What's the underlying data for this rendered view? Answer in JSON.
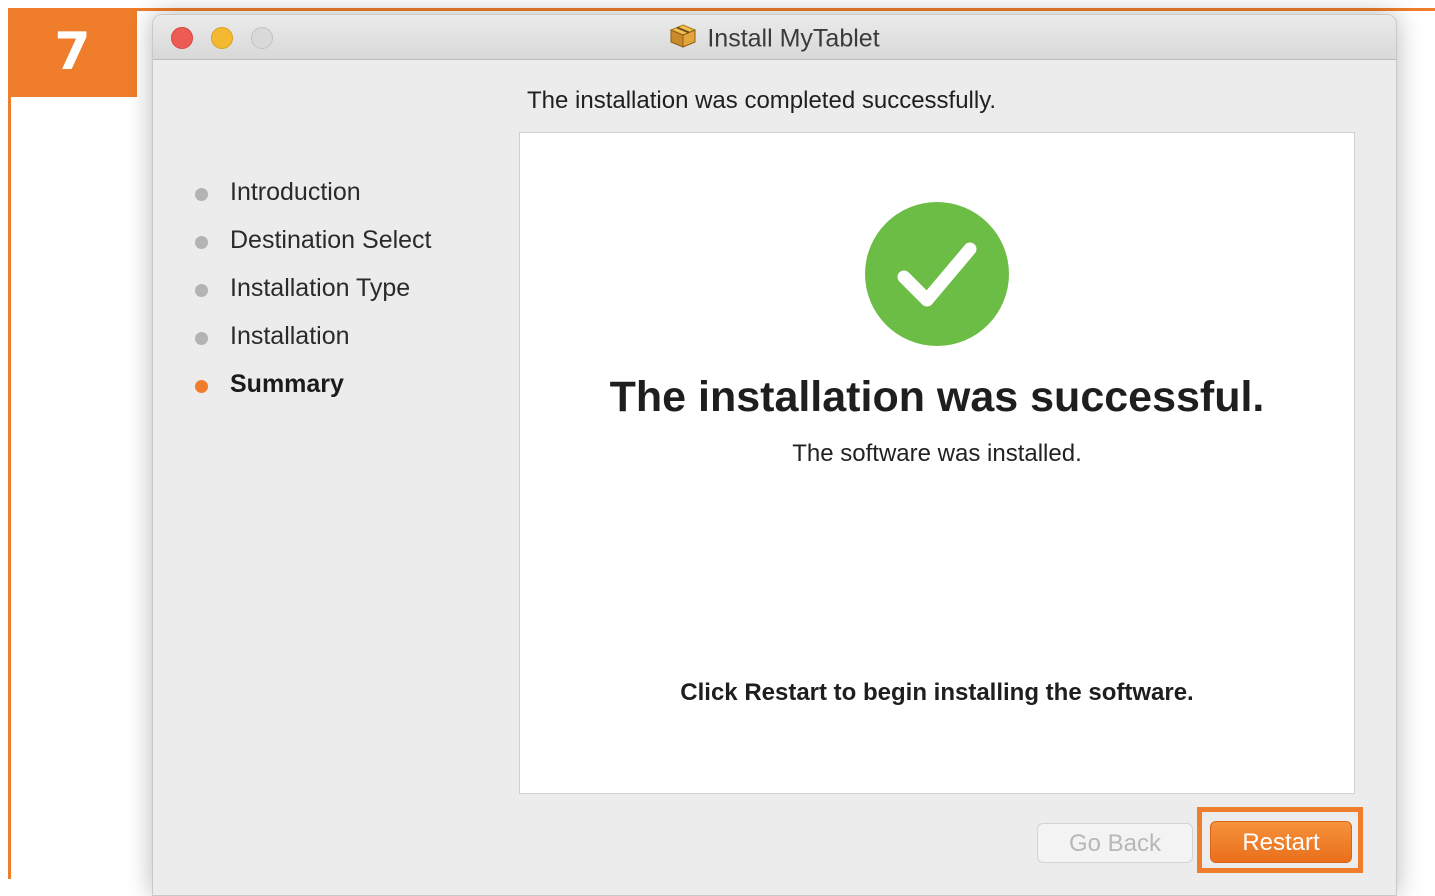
{
  "step": {
    "number": "7"
  },
  "window": {
    "title": "Install MyTablet",
    "header": "The installation was completed successfully."
  },
  "sidebar": {
    "items": [
      {
        "label": "Introduction",
        "active": false
      },
      {
        "label": "Destination Select",
        "active": false
      },
      {
        "label": "Installation Type",
        "active": false
      },
      {
        "label": "Installation",
        "active": false
      },
      {
        "label": "Summary",
        "active": true
      }
    ]
  },
  "content": {
    "title": "The installation was successful.",
    "subtitle": "The software was installed.",
    "note": "Click Restart to begin installing the software."
  },
  "buttons": {
    "back_label": "Go Back",
    "restart_label": "Restart"
  },
  "colors": {
    "accent": "#ef7d2b",
    "success_green": "#6cbd45",
    "close": "#ee5b55",
    "minimize": "#f4b931",
    "zoom": "#d9d9d9"
  },
  "icons": {
    "success": "checkmark-circle-icon",
    "package": "package-icon"
  }
}
